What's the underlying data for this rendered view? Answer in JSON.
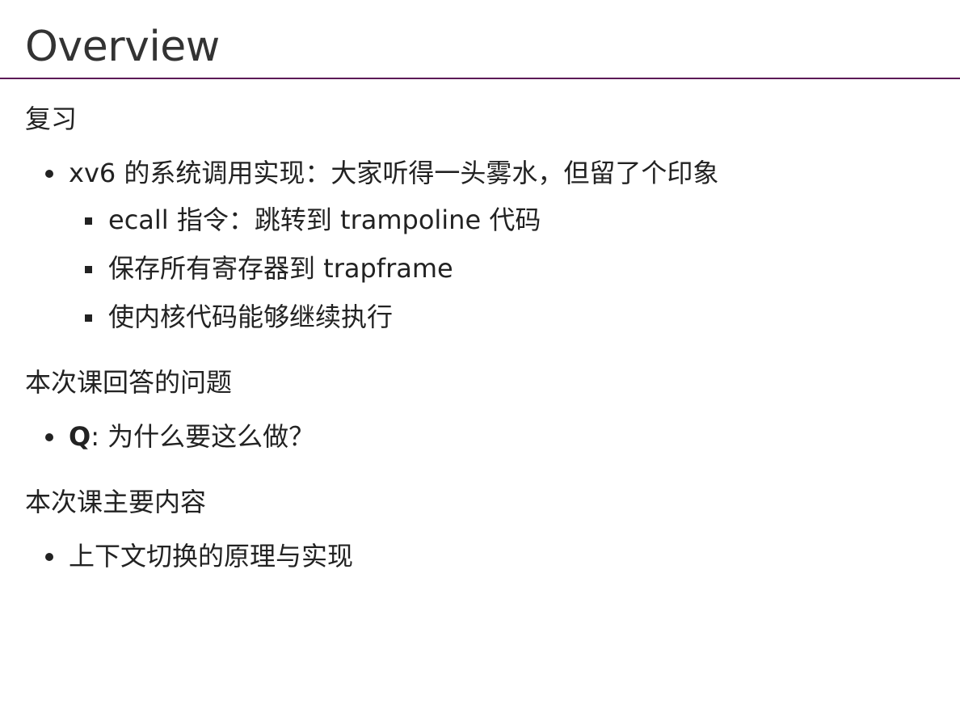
{
  "slide": {
    "title": "Overview",
    "rule_color": "#5c1a57"
  },
  "sections": {
    "review": {
      "heading": "复习",
      "item": "xv6 的系统调用实现：大家听得一头雾水，但留了个印象",
      "subitems": [
        "ecall 指令：跳转到 trampoline 代码",
        "保存所有寄存器到 trapframe",
        "使内核代码能够继续执行"
      ]
    },
    "question": {
      "heading": "本次课回答的问题",
      "q_label": "Q",
      "q_text": ": 为什么要这么做？"
    },
    "main": {
      "heading": "本次课主要内容",
      "item": "上下文切换的原理与实现"
    }
  }
}
